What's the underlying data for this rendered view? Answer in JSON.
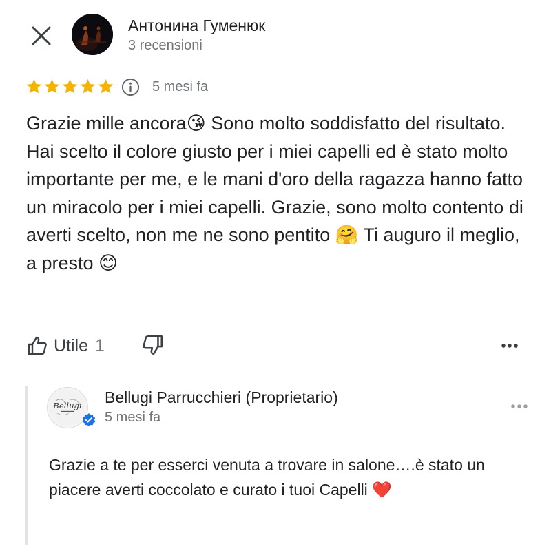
{
  "review": {
    "author_name": "Антонина Гуменюк",
    "author_meta": "3 recensioni",
    "rating": 5,
    "max_rating": 5,
    "date": "5 mesi fa",
    "text": "Grazie mille ancora😘 Sono molto soddisfatto del risultato. Hai scelto il colore giusto per i miei capelli ed è stato molto importante per me, e le mani d'oro della ragazza hanno fatto un miracolo per i miei capelli. Grazie, sono molto contento di averti scelto, non me ne sono pentito 🤗 Ti auguro il meglio, a presto 😊"
  },
  "actions": {
    "like_label": "Utile",
    "like_count": "1"
  },
  "owner_reply": {
    "name": "Bellugi Parrucchieri (Proprietario)",
    "date": "5 mesi fa",
    "logo_text": "Bellugi",
    "text": "Grazie a te per esserci venuta a trovare in salone….è stato un piacere averti coccolato e curato i tuoi Capelli ❤️"
  },
  "icons": {
    "close": "close-icon",
    "info": "info-icon",
    "like": "thumbs-up-icon",
    "dislike": "thumbs-down-icon",
    "more": "more-horizontal-icon",
    "verified": "verified-badge-icon",
    "star": "star-icon"
  },
  "colors": {
    "star": "#f4b400",
    "verified": "#1a73e8",
    "secondary_text": "#70757a",
    "reply_bar": "#e3e3e3"
  }
}
